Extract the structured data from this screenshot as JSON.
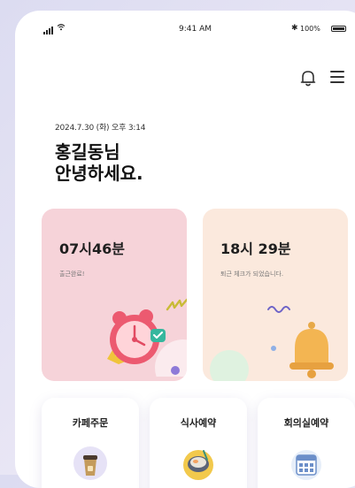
{
  "status_bar": {
    "time": "9:41 AM",
    "battery": "100%",
    "bluetooth": "bluetooth-icon"
  },
  "header": {
    "bell_icon": "bell-icon",
    "menu_icon": "hamburger-menu-icon"
  },
  "greeting": {
    "datetime": "2024.7.30 (화) 오후 3:14",
    "line1": "홍길동님",
    "line2": "안녕하세요."
  },
  "attendance_cards": [
    {
      "time": "07시46분",
      "status": "출근완료!",
      "bg": "#f6d3d9",
      "icon": "alarm-clock-icon"
    },
    {
      "time": "18시 29분",
      "status": "퇴근 체크가 되었습니다.",
      "bg": "#fbe9dd",
      "icon": "bell-icon"
    }
  ],
  "menu_cards": [
    {
      "label": "카페주문",
      "icon": "coffee-cup-icon"
    },
    {
      "label": "식사예약",
      "icon": "meal-bowl-icon"
    },
    {
      "label": "회의실예약",
      "icon": "calendar-icon"
    }
  ]
}
